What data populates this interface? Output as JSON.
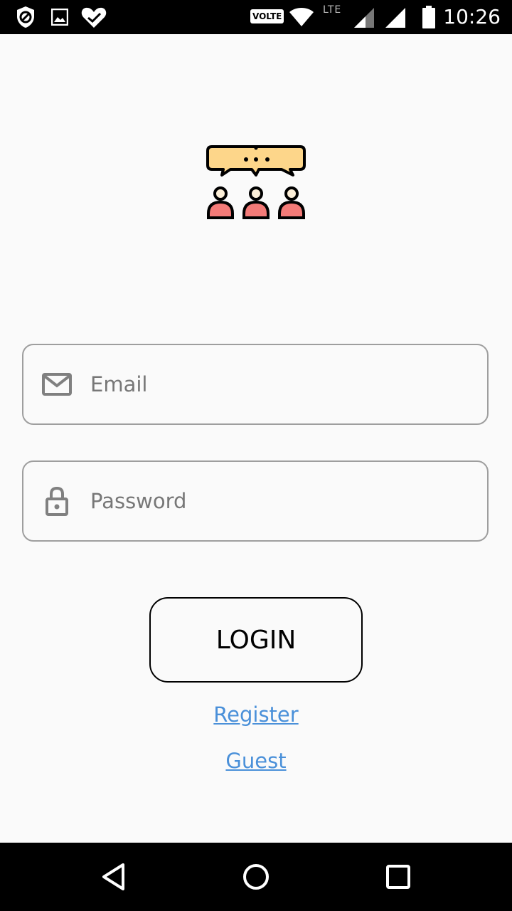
{
  "status_bar": {
    "time": "10:26",
    "volte_label": "VOLTE",
    "lte_label": "LTE",
    "icons": [
      "shield-block-icon",
      "image-icon",
      "heart-check-icon",
      "wifi-icon",
      "signal-icon",
      "signal-full-icon",
      "battery-icon"
    ]
  },
  "logo": {
    "icon": "chat-group-icon",
    "colors": {
      "bubble": "#fdd68a",
      "person": "#f47b78",
      "head": "#fcefd8"
    }
  },
  "form": {
    "email": {
      "icon": "mail-icon",
      "placeholder": "Email",
      "value": ""
    },
    "password": {
      "icon": "lock-icon",
      "placeholder": "Password",
      "value": ""
    }
  },
  "actions": {
    "login_label": "LOGIN",
    "register_label": "Register",
    "guest_label": "Guest"
  },
  "nav_bar": {
    "icons": [
      "back-icon",
      "home-icon",
      "recents-icon"
    ]
  },
  "colors": {
    "link": "#4a90d9",
    "background": "#fafafa",
    "field_border": "#9e9e9e"
  }
}
